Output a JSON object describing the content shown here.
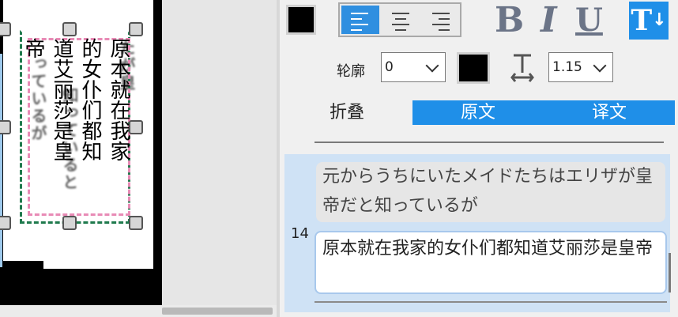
{
  "canvas": {
    "jp_columns": [
      "たが皇",
      "っているが",
      "知っていると"
    ],
    "cn_columns": [
      "原本就在我家",
      "的女仆们都知",
      "道艾丽莎是皇",
      "帝"
    ]
  },
  "toolbar": {
    "text_color": "#000000",
    "align_left_active": true,
    "bold_label": "B",
    "italic_label": "I",
    "underline_label": "U",
    "vertical_text_label": "T"
  },
  "outline": {
    "label": "轮廓",
    "width_value": "0",
    "color": "#000000",
    "line_spacing_value": "1.15"
  },
  "tabs": {
    "collapse": "折叠",
    "original": "原文",
    "translation": "译文"
  },
  "entry": {
    "index": "14",
    "source_text": "元からうちにいたメイドたちはエリザが皇帝だと知っているが",
    "translation_text": "原本就在我家的女仆们都知道艾丽莎是皇帝"
  },
  "colors": {
    "accent": "#1f8fe8",
    "selected_row": "#cfe2f5"
  }
}
